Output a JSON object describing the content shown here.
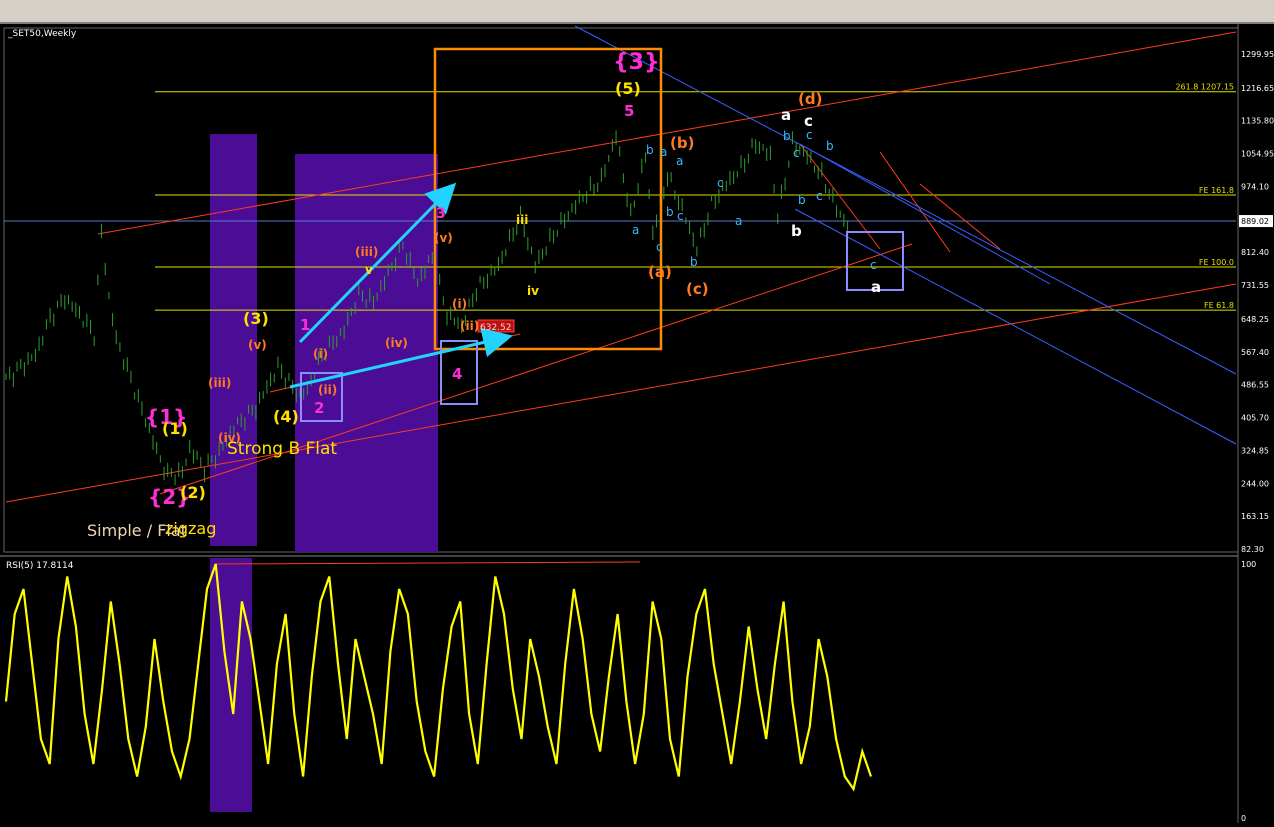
{
  "window": {
    "symbol_label": "_SET50,Weekly",
    "rsi_label": "RSI(5) 17.8114"
  },
  "colors": {
    "background": "#000000",
    "candles": "#2e9e2e",
    "rsi": "#ffff00",
    "fib_lines": "#e0e000",
    "channel_red": "#ff3b1f",
    "channel_blue": "#3a5fff",
    "arrow_cyan": "#22d3ff",
    "box_orange": "#ff8c00",
    "box_lavender": "#8c8cff",
    "shade_purple": "#4b0d96",
    "magenta": "#ff2dd6",
    "yellow_label": "#ffe000",
    "orange_label": "#ff7a20",
    "white_label": "#ffffff",
    "cyan_label": "#3ab8ff"
  },
  "chart_data": [
    {
      "type": "line",
      "title": "_SET50,Weekly",
      "y_ticks": [
        "1299.95",
        "1216.65",
        "1135.80",
        "1054.95",
        "974.10",
        "812.40",
        "731.55",
        "648.25",
        "567.40",
        "486.55",
        "405.70",
        "324.85",
        "244.00",
        "163.15",
        "82.30"
      ],
      "current_price": "889.02",
      "ylim": [
        82.3,
        1299.95
      ],
      "price_path": [
        [
          0,
          500
        ],
        [
          4,
          560
        ],
        [
          6,
          650
        ],
        [
          8,
          700
        ],
        [
          10,
          660
        ],
        [
          12,
          610
        ],
        [
          13,
          860
        ],
        [
          14,
          700
        ],
        [
          15,
          600
        ],
        [
          17,
          500
        ],
        [
          19,
          400
        ],
        [
          21,
          300
        ],
        [
          22,
          265
        ],
        [
          24,
          270
        ],
        [
          25,
          330
        ],
        [
          27,
          280
        ],
        [
          29,
          320
        ],
        [
          31,
          380
        ],
        [
          34,
          430
        ],
        [
          37,
          530
        ],
        [
          39,
          480
        ],
        [
          40,
          460
        ],
        [
          41,
          475
        ],
        [
          43,
          560
        ],
        [
          46,
          620
        ],
        [
          48,
          710
        ],
        [
          50,
          690
        ],
        [
          52,
          760
        ],
        [
          54,
          830
        ],
        [
          56,
          740
        ],
        [
          58,
          800
        ],
        [
          60,
          660
        ],
        [
          62,
          630
        ],
        [
          64,
          720
        ],
        [
          67,
          780
        ],
        [
          70,
          900
        ],
        [
          72,
          780
        ],
        [
          75,
          870
        ],
        [
          78,
          940
        ],
        [
          81,
          990
        ],
        [
          83,
          1100
        ],
        [
          85,
          900
        ],
        [
          87,
          1050
        ],
        [
          88,
          860
        ],
        [
          90,
          1000
        ],
        [
          92,
          920
        ],
        [
          94,
          820
        ],
        [
          96,
          930
        ],
        [
          98,
          980
        ],
        [
          100,
          1020
        ],
        [
          102,
          1080
        ],
        [
          104,
          1050
        ],
        [
          105,
          900
        ],
        [
          107,
          1080
        ],
        [
          109,
          1050
        ],
        [
          111,
          1000
        ],
        [
          113,
          920
        ],
        [
          115,
          860
        ]
      ],
      "fib_levels": [
        {
          "label": "261.8 1207.15",
          "value": 1207.15
        },
        {
          "label": "FE 161.8",
          "value": 953
        },
        {
          "label": "FE 100.0",
          "value": 776
        },
        {
          "label": "FE 61.8",
          "value": 670
        }
      ],
      "wave_labels": [
        {
          "text": "{1}",
          "color": "magenta"
        },
        {
          "text": "{2}",
          "color": "magenta"
        },
        {
          "text": "{3}",
          "color": "magenta"
        },
        {
          "text": "(1)",
          "color": "yellow"
        },
        {
          "text": "(2)",
          "color": "yellow"
        },
        {
          "text": "(3)",
          "color": "yellow"
        },
        {
          "text": "(4)",
          "color": "yellow"
        },
        {
          "text": "(5)",
          "color": "yellow"
        },
        {
          "text": "1",
          "color": "magenta"
        },
        {
          "text": "2",
          "color": "magenta"
        },
        {
          "text": "3",
          "color": "magenta"
        },
        {
          "text": "4",
          "color": "magenta"
        },
        {
          "text": "5",
          "color": "magenta"
        },
        {
          "text": "(iii)",
          "color": "orange"
        },
        {
          "text": "(v)",
          "color": "orange"
        },
        {
          "text": "(i)",
          "color": "orange"
        },
        {
          "text": "(ii)",
          "color": "orange"
        },
        {
          "text": "(iv)",
          "color": "orange"
        },
        {
          "text": "(iii)",
          "color": "orange"
        },
        {
          "text": "(iv)",
          "color": "orange"
        },
        {
          "text": "(v)",
          "color": "orange"
        },
        {
          "text": "(i)",
          "color": "orange"
        },
        {
          "text": "(ii)",
          "color": "orange"
        },
        {
          "text": "(a)",
          "color": "orange"
        },
        {
          "text": "(b)",
          "color": "orange"
        },
        {
          "text": "(c)",
          "color": "orange"
        },
        {
          "text": "(d)",
          "color": "orange"
        },
        {
          "text": "iii",
          "color": "yellow"
        },
        {
          "text": "iv",
          "color": "yellow"
        },
        {
          "text": "v",
          "color": "yellow"
        },
        {
          "text": "a",
          "color": "white"
        },
        {
          "text": "b",
          "color": "white"
        },
        {
          "text": "c",
          "color": "white"
        },
        {
          "text": "a",
          "color": "white"
        }
      ],
      "small_wave_letters": [
        "a",
        "b",
        "c",
        "a",
        "b",
        "c",
        "a",
        "b",
        "c",
        "a",
        "b",
        "c",
        "c",
        "c",
        "b",
        "b",
        "c"
      ],
      "annotations": [
        "Strong B Flat",
        "Simple / Flat",
        "zigzag",
        "632.52"
      ]
    },
    {
      "type": "line",
      "title": "RSI(5) 17.8114",
      "ylim": [
        0,
        100
      ],
      "y_ticks": [
        "100",
        "0"
      ],
      "values": [
        45,
        80,
        90,
        60,
        30,
        20,
        70,
        95,
        75,
        40,
        20,
        50,
        85,
        60,
        30,
        15,
        35,
        70,
        45,
        25,
        15,
        30,
        60,
        90,
        100,
        65,
        40,
        85,
        70,
        45,
        20,
        60,
        80,
        40,
        15,
        55,
        85,
        95,
        60,
        30,
        70,
        55,
        40,
        20,
        65,
        90,
        80,
        45,
        25,
        15,
        50,
        75,
        85,
        40,
        20,
        60,
        95,
        80,
        50,
        30,
        70,
        55,
        35,
        20,
        60,
        90,
        70,
        40,
        25,
        55,
        80,
        45,
        20,
        40,
        85,
        70,
        30,
        15,
        55,
        80,
        90,
        60,
        40,
        20,
        45,
        75,
        50,
        30,
        60,
        85,
        45,
        20,
        35,
        70,
        55,
        30,
        15,
        10,
        25,
        15
      ]
    }
  ]
}
